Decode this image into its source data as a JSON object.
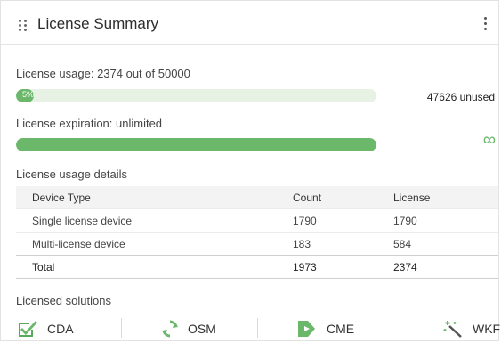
{
  "card": {
    "title": "License Summary"
  },
  "usage": {
    "label": "License usage: 2374 out of 50000",
    "percent_text": "5%",
    "percent": 5,
    "unused_text": "47626 unused"
  },
  "expiration": {
    "label": "License expiration: unlimited",
    "percent": 100,
    "symbol": "∞"
  },
  "details": {
    "label": "License usage details",
    "columns": [
      "Device Type",
      "Count",
      "License"
    ],
    "rows": [
      [
        "Single license device",
        "1790",
        "1790"
      ],
      [
        "Multi-license device",
        "183",
        "584"
      ]
    ],
    "total": [
      "Total",
      "1973",
      "2374"
    ]
  },
  "solutions": {
    "label": "Licensed solutions",
    "items": [
      {
        "name": "CDA",
        "icon": "checkbox-shield-icon"
      },
      {
        "name": "OSM",
        "icon": "sync-arrows-icon"
      },
      {
        "name": "CME",
        "icon": "tag-arrow-icon"
      },
      {
        "name": "WKF",
        "icon": "magic-wand-icon"
      }
    ]
  },
  "colors": {
    "accent": "#6bb86a",
    "track": "#e7f2e5"
  }
}
